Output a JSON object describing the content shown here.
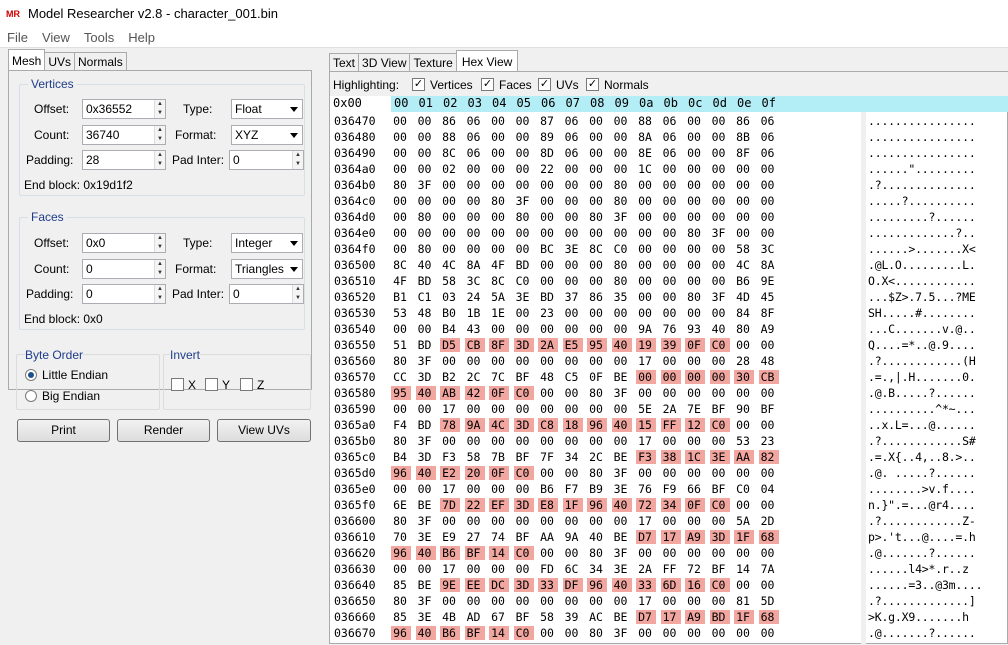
{
  "window": {
    "icon_text": "MR",
    "title": "Model Researcher v2.8 - character_001.bin"
  },
  "menu": [
    "File",
    "View",
    "Tools",
    "Help"
  ],
  "left_tabs": [
    "Mesh",
    "UVs",
    "Normals"
  ],
  "vertices": {
    "title": "Vertices",
    "offset_label": "Offset:",
    "offset": "0x36552",
    "count_label": "Count:",
    "count": "36740",
    "padding_label": "Padding:",
    "padding": "28",
    "type_label": "Type:",
    "type": "Float",
    "format_label": "Format:",
    "format": "XYZ",
    "padinter_label": "Pad Inter:",
    "padinter": "0",
    "end_block": "End block: 0x19d1f2"
  },
  "faces": {
    "title": "Faces",
    "offset_label": "Offset:",
    "offset": "0x0",
    "count_label": "Count:",
    "count": "0",
    "padding_label": "Padding:",
    "padding": "0",
    "type_label": "Type:",
    "type": "Integer",
    "format_label": "Format:",
    "format": "Triangles",
    "padinter_label": "Pad Inter:",
    "padinter": "0",
    "end_block": "End block: 0x0"
  },
  "byte_order": {
    "title": "Byte Order",
    "little": "Little Endian",
    "big": "Big Endian",
    "selected": "little"
  },
  "invert": {
    "title": "Invert",
    "x": "X",
    "y": "Y",
    "z": "Z"
  },
  "buttons": {
    "print": "Print",
    "render": "Render",
    "view_uvs": "View UVs"
  },
  "right_tabs": [
    "Text",
    "3D View",
    "Texture",
    "Hex View"
  ],
  "highlighting": {
    "label": "Highlighting:",
    "vertices": "Vertices",
    "faces": "Faces",
    "uvs": "UVs",
    "normals": "Normals"
  },
  "hex": {
    "corner": "0x00",
    "columns": [
      "00",
      "01",
      "02",
      "03",
      "04",
      "05",
      "06",
      "07",
      "08",
      "09",
      "0a",
      "0b",
      "0c",
      "0d",
      "0e",
      "0f"
    ],
    "highlight_color": "#f2a6a0",
    "rows": [
      {
        "addr": "036470",
        "bytes": "00 00 86 06 00 00 87 06 00 00 88 06 00 00 86 06",
        "ascii": "................",
        "hl": []
      },
      {
        "addr": "036480",
        "bytes": "00 00 88 06 00 00 89 06 00 00 8A 06 00 00 8B 06",
        "ascii": "................",
        "hl": []
      },
      {
        "addr": "036490",
        "bytes": "00 00 8C 06 00 00 8D 06 00 00 8E 06 00 00 8F 06",
        "ascii": "................",
        "hl": []
      },
      {
        "addr": "0364a0",
        "bytes": "00 00 02 00 00 00 22 00 00 00 1C 00 00 00 00 00",
        "ascii": "......\".........",
        "hl": []
      },
      {
        "addr": "0364b0",
        "bytes": "80 3F 00 00 00 00 00 00 00 80 00 00 00 00 00 00",
        "ascii": ".?..............",
        "hl": []
      },
      {
        "addr": "0364c0",
        "bytes": "00 00 00 00 80 3F 00 00 00 80 00 00 00 00 00 00",
        "ascii": ".....?..........",
        "hl": []
      },
      {
        "addr": "0364d0",
        "bytes": "00 80 00 00 00 80 00 00 80 3F 00 00 00 00 00 00",
        "ascii": ".........?......",
        "hl": []
      },
      {
        "addr": "0364e0",
        "bytes": "00 00 00 00 00 00 00 00 00 00 00 00 80 3F 00 00",
        "ascii": ".............?..",
        "hl": []
      },
      {
        "addr": "0364f0",
        "bytes": "00 80 00 00 00 00 BC 3E 8C C0 00 00 00 00 58 3C",
        "ascii": "......>.......X<",
        "hl": []
      },
      {
        "addr": "036500",
        "bytes": "8C 40 4C 8A 4F BD 00 00 00 80 00 00 00 00 4C 8A",
        "ascii": ".@L.O.........L.",
        "hl": []
      },
      {
        "addr": "036510",
        "bytes": "4F BD 58 3C 8C C0 00 00 00 80 00 00 00 00 B6 9E",
        "ascii": "O.X<............",
        "hl": []
      },
      {
        "addr": "036520",
        "bytes": "B1 C1 03 24 5A 3E BD 37 86 35 00 00 80 3F 4D 45",
        "ascii": "...$Z>.7.5...?ME",
        "hl": []
      },
      {
        "addr": "036530",
        "bytes": "53 48 B0 1B 1E 00 23 00 00 00 00 00 00 00 84 8F",
        "ascii": "SH.....#........",
        "hl": []
      },
      {
        "addr": "036540",
        "bytes": "00 00 B4 43 00 00 00 00 00 00 9A 76 93 40 80 A9",
        "ascii": "...C.......v.@..",
        "hl": []
      },
      {
        "addr": "036550",
        "bytes": "51 BD D5 CB 8F 3D 2A E5 95 40 19 39 0F C0 00 00",
        "ascii": "Q....=*..@.9....",
        "hl": [
          2,
          3,
          4,
          5,
          6,
          7,
          8,
          9,
          10,
          11,
          12,
          13
        ]
      },
      {
        "addr": "036560",
        "bytes": "80 3F 00 00 00 00 00 00 00 00 17 00 00 00 28 48",
        "ascii": ".?............(H",
        "hl": []
      },
      {
        "addr": "036570",
        "bytes": "CC 3D B2 2C 7C BF 48 C5 0F BE 00 00 00 00 30 CB",
        "ascii": ".=.,|.H.......0.",
        "hl": [
          10,
          11,
          12,
          13,
          14,
          15
        ]
      },
      {
        "addr": "036580",
        "bytes": "95 40 AB 42 0F C0 00 00 80 3F 00 00 00 00 00 00",
        "ascii": ".@.B.....?......",
        "hl": [
          0,
          1,
          2,
          3,
          4,
          5
        ]
      },
      {
        "addr": "036590",
        "bytes": "00 00 17 00 00 00 00 00 00 00 5E 2A 7E BF 90 BF",
        "ascii": "..........^*~...",
        "hl": []
      },
      {
        "addr": "0365a0",
        "bytes": "F4 BD 78 9A 4C 3D C8 18 96 40 15 FF 12 C0 00 00",
        "ascii": "..x.L=...@......",
        "hl": [
          2,
          3,
          4,
          5,
          6,
          7,
          8,
          9,
          10,
          11,
          12,
          13
        ]
      },
      {
        "addr": "0365b0",
        "bytes": "80 3F 00 00 00 00 00 00 00 00 17 00 00 00 53 23",
        "ascii": ".?............S#",
        "hl": []
      },
      {
        "addr": "0365c0",
        "bytes": "B4 3D F3 58 7B BF 7F 34 2C BE F3 38 1C 3E AA 82",
        "ascii": ".=.X{..4,..8.>..",
        "hl": [
          10,
          11,
          12,
          13,
          14,
          15
        ]
      },
      {
        "addr": "0365d0",
        "bytes": "96 40 E2 20 0F C0 00 00 80 3F 00 00 00 00 00 00",
        "ascii": ".@. .....?......",
        "hl": [
          0,
          1,
          2,
          3,
          4,
          5
        ]
      },
      {
        "addr": "0365e0",
        "bytes": "00 00 17 00 00 00 B6 F7 B9 3E 76 F9 66 BF C0 04",
        "ascii": "........>v.f....",
        "hl": []
      },
      {
        "addr": "0365f0",
        "bytes": "6E BE 7D 22 EF 3D E8 1F 96 40 72 34 0F C0 00 00",
        "ascii": "n.}\".=...@r4....",
        "hl": [
          2,
          3,
          4,
          5,
          6,
          7,
          8,
          9,
          10,
          11,
          12,
          13
        ]
      },
      {
        "addr": "036600",
        "bytes": "80 3F 00 00 00 00 00 00 00 00 17 00 00 00 5A 2D",
        "ascii": ".?............Z-",
        "hl": []
      },
      {
        "addr": "036610",
        "bytes": "70 3E E9 27 74 BF AA 9A 40 BE D7 17 A9 3D 1F 68",
        "ascii": "p>.'t...@....=.h",
        "hl": [
          10,
          11,
          12,
          13,
          14,
          15
        ]
      },
      {
        "addr": "036620",
        "bytes": "96 40 B6 BF 14 C0 00 00 80 3F 00 00 00 00 00 00",
        "ascii": ".@.......?......",
        "hl": [
          0,
          1,
          2,
          3,
          4,
          5
        ]
      },
      {
        "addr": "036630",
        "bytes": "00 00 17 00 00 00 FD 6C 34 3E 2A FF 72 BF 14 7A",
        "ascii": "......l4>*.r..z",
        "hl": []
      },
      {
        "addr": "036640",
        "bytes": "85 BE 9E EE DC 3D 33 DF 96 40 33 6D 16 C0 00 00",
        "ascii": "......=3..@3m....",
        "hl": [
          2,
          3,
          4,
          5,
          6,
          7,
          8,
          9,
          10,
          11,
          12,
          13
        ]
      },
      {
        "addr": "036650",
        "bytes": "80 3F 00 00 00 00 00 00 00 00 17 00 00 00 81 5D",
        "ascii": ".?.............]",
        "hl": []
      },
      {
        "addr": "036660",
        "bytes": "85 3E 4B AD 67 BF 58 39 AC BE D7 17 A9 BD 1F 68",
        "ascii": ">K.g.X9.......h",
        "hl": [
          10,
          11,
          12,
          13,
          14,
          15
        ]
      },
      {
        "addr": "036670",
        "bytes": "96 40 B6 BF 14 C0 00 00 80 3F 00 00 00 00 00 00",
        "ascii": ".@.......?......",
        "hl": [
          0,
          1,
          2,
          3,
          4,
          5
        ]
      }
    ]
  }
}
